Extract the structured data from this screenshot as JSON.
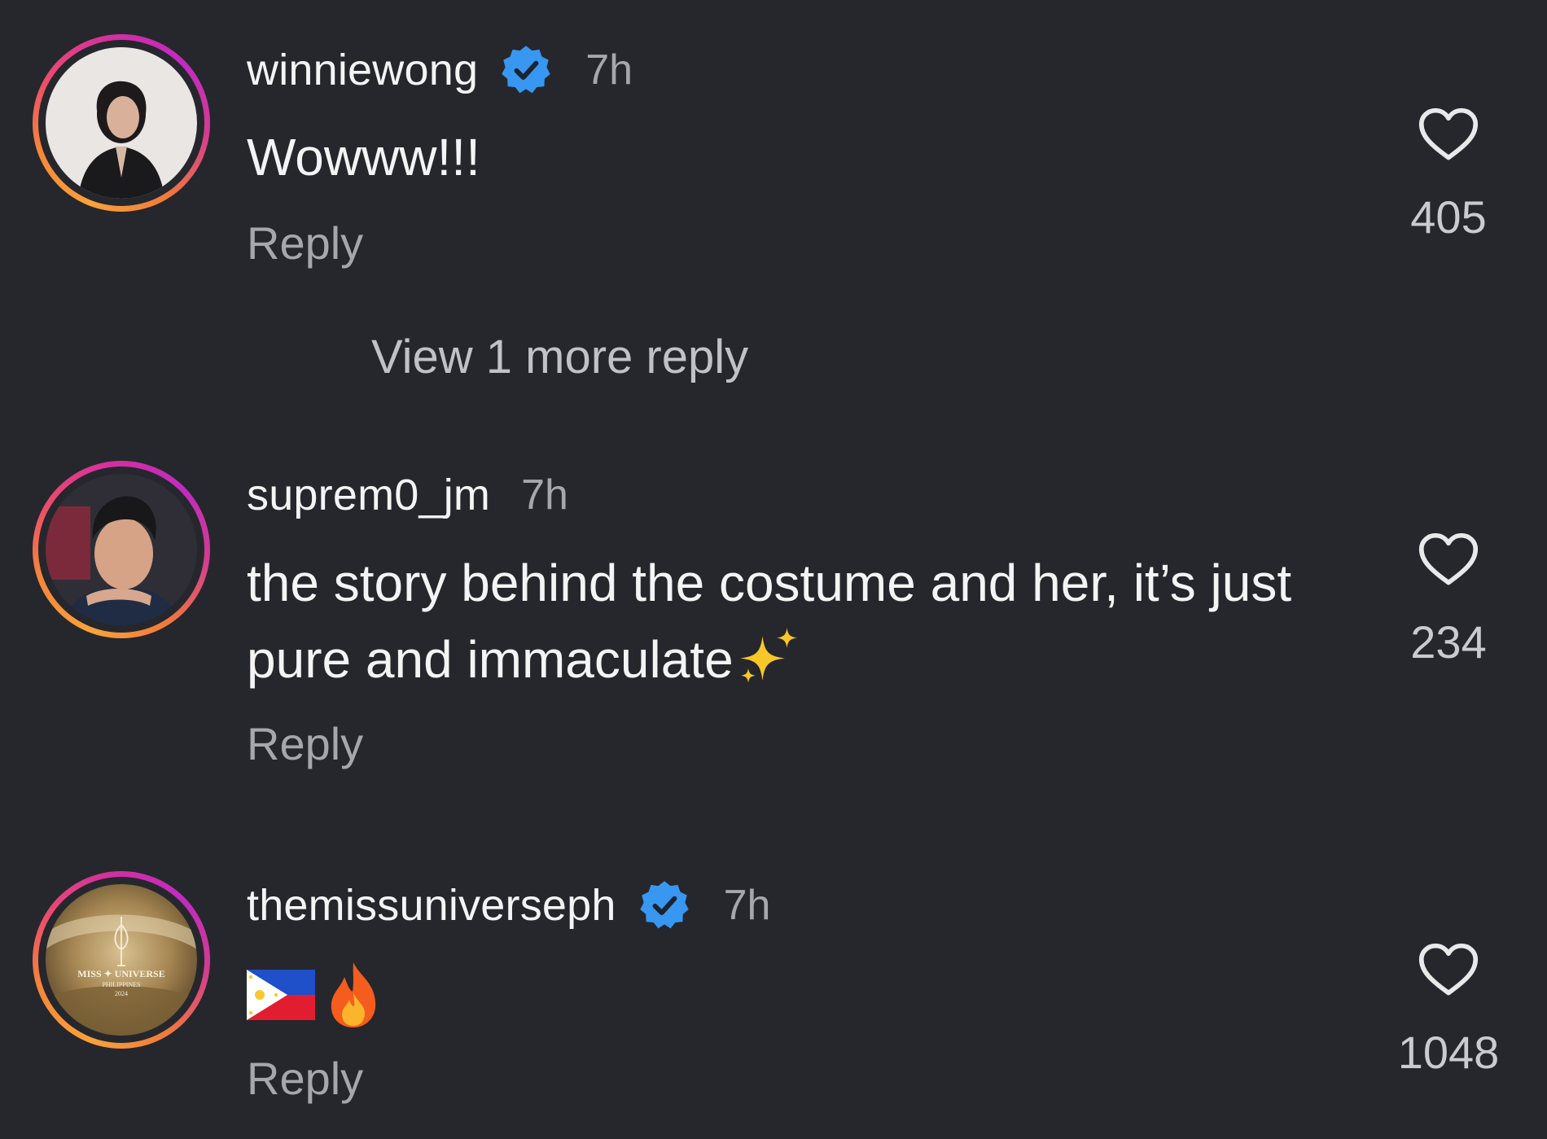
{
  "comments": [
    {
      "username": "winniewong",
      "verified": true,
      "time": "7h",
      "text": "Wowww!!!",
      "reply_label": "Reply",
      "likes": "405"
    },
    {
      "username": "suprem0_jm",
      "verified": false,
      "time": "7h",
      "text": "the story behind the costume and her, it’s just pure and immaculate",
      "text_emoji": "sparkles",
      "reply_label": "Reply",
      "likes": "234"
    },
    {
      "username": "themissuniverseph",
      "verified": true,
      "time": "7h",
      "text_emojis": [
        "philippines-flag",
        "fire"
      ],
      "reply_label": "Reply",
      "likes": "1048",
      "avatar_text": [
        "MISS ✦ UNIVERSE",
        "PHILIPPINES",
        "2024"
      ]
    }
  ],
  "view_more_replies": "View 1 more reply",
  "colors": {
    "background": "#25272c",
    "verified_blue": "#3897f0",
    "secondary_text": "#a4a7ad"
  }
}
